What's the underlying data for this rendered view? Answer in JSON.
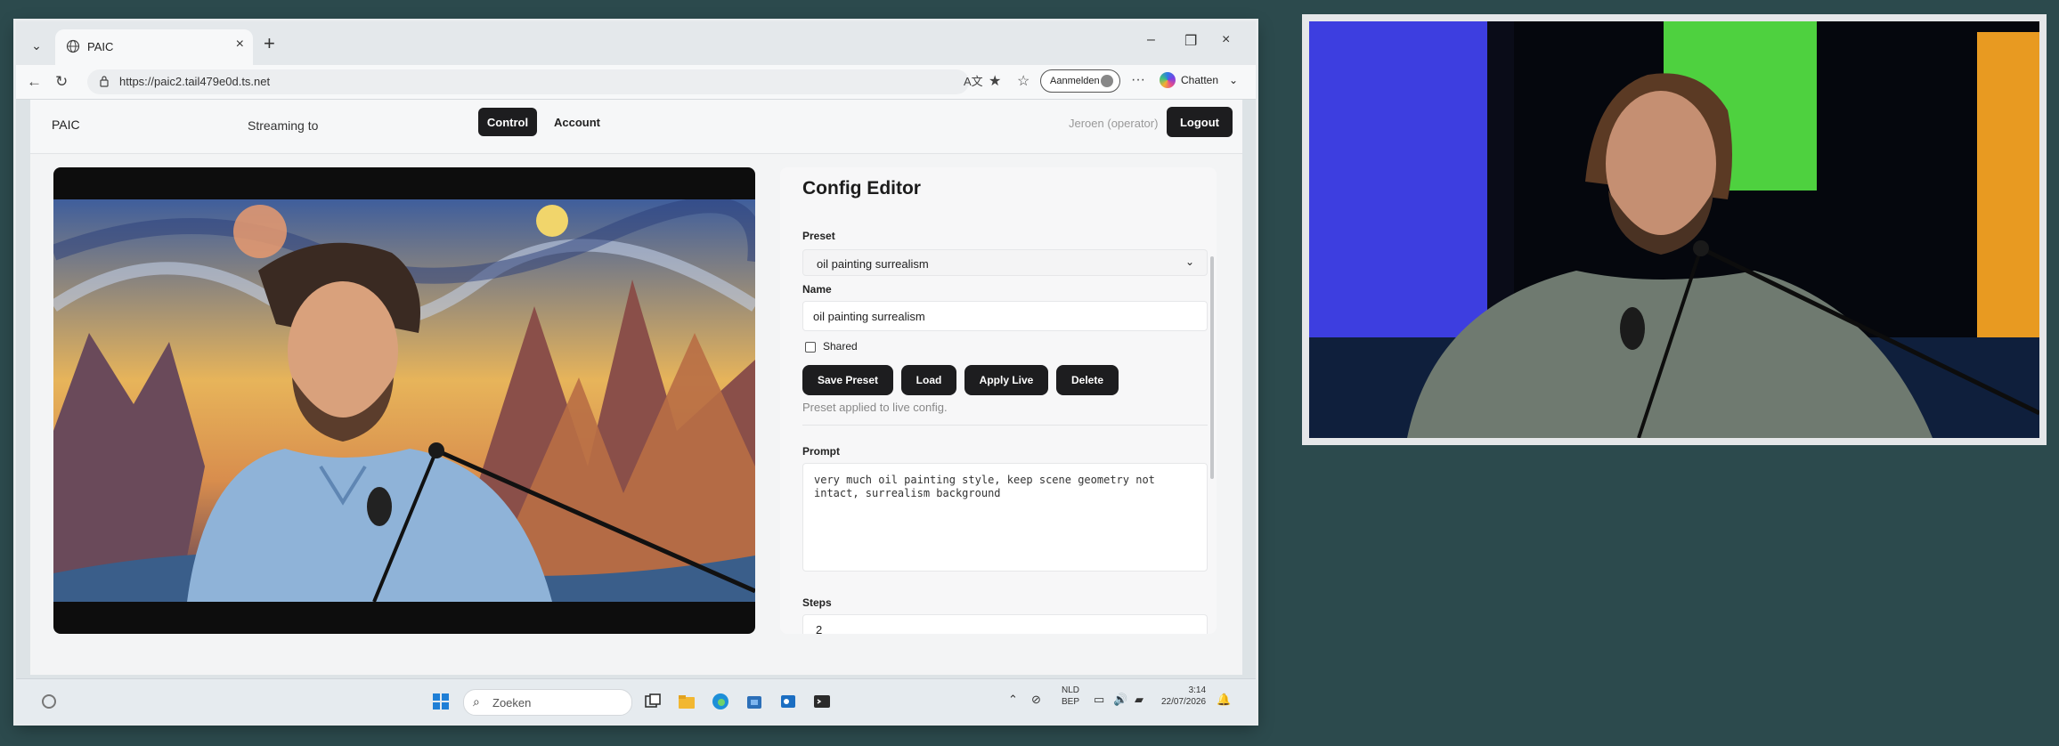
{
  "browser": {
    "tab_title": "PAIC",
    "url": "https://paic2.tail479e0d.ts.net",
    "signin_label": "Aanmelden",
    "chat_label": "Chatten"
  },
  "app": {
    "brand": "PAIC",
    "streaming_label": "Streaming to",
    "nav": {
      "control": "Control",
      "account": "Account"
    },
    "user": "Jeroen (operator)",
    "logout": "Logout"
  },
  "config": {
    "title": "Config Editor",
    "preset_label": "Preset",
    "preset_value": "oil painting surrealism",
    "name_label": "Name",
    "name_value": "oil painting surrealism",
    "shared_label": "Shared",
    "buttons": {
      "save": "Save Preset",
      "load": "Load",
      "apply": "Apply Live",
      "delete": "Delete"
    },
    "status": "Preset applied to live config.",
    "prompt_label": "Prompt",
    "prompt_value": "very much oil painting style, keep scene geometry not\nintact, surrealism background",
    "steps_label": "Steps",
    "steps_value": "2"
  },
  "taskbar": {
    "search_placeholder": "Zoeken",
    "lang_line1": "NLD",
    "lang_line2": "BEP",
    "time": "3:14",
    "date": "22/07/2026"
  }
}
